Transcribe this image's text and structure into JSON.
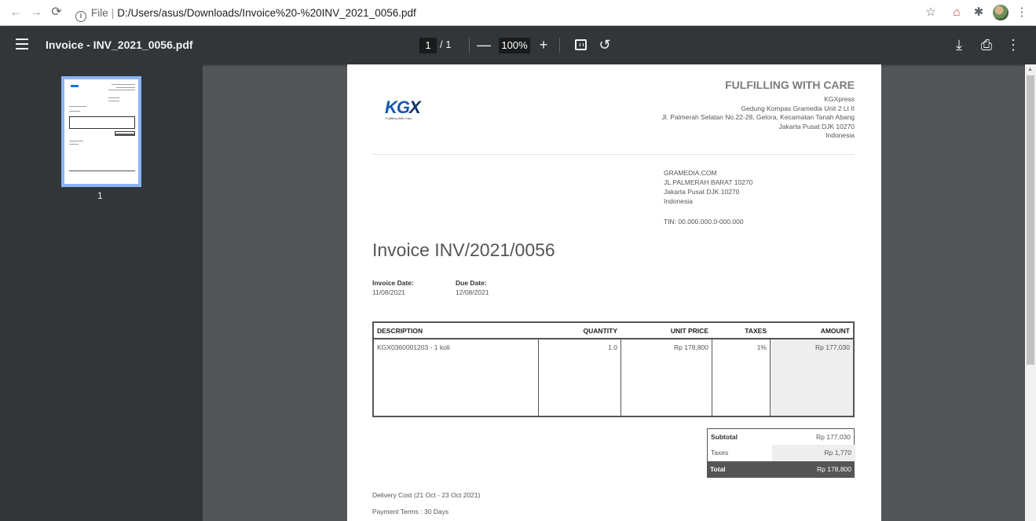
{
  "browser": {
    "nav": {
      "back": "←",
      "forward": "→",
      "reload": "⟳"
    },
    "url": {
      "scheme": "File",
      "path": "D:/Users/asus/Downloads/Invoice%20-%20INV_2021_0056.pdf"
    }
  },
  "viewer": {
    "title": "Invoice - INV_2021_0056.pdf",
    "page_current": "1",
    "page_total": "/ 1",
    "zoom": "100%",
    "zoom_out": "—",
    "zoom_in": "+",
    "rotate": "↺",
    "download": "⤓",
    "print": "⎙",
    "more": "⋮"
  },
  "sidebar": {
    "thumb_label": "1"
  },
  "invoice": {
    "logo": {
      "text_main": "KG",
      "text_x": "X",
      "tagline": "Fulfilling With Care"
    },
    "company": {
      "motto": "FULFILLING WITH CARE",
      "lines": [
        "KGXpress",
        "Gedung Kompas Gramedia Unit 2 Lt II",
        "Jl. Palmerah Selatan No.22-28, Gelora, Kecamatan Tanah Abang",
        "Jakarta Pusat DJK 10270",
        "Indonesia"
      ]
    },
    "customer": {
      "lines": [
        "GRAMEDIA.COM",
        "JL.PALMERAH BARAT 10270",
        "Jakarta Pusat DJK 10270",
        "Indonesia"
      ],
      "tin": "TIN: 00.000.000.0-000.000"
    },
    "title": "Invoice INV/2021/0056",
    "invoice_date": {
      "label": "Invoice Date:",
      "value": "11/08/2021"
    },
    "due_date": {
      "label": "Due Date:",
      "value": "12/08/2021"
    },
    "table": {
      "headers": {
        "description": "DESCRIPTION",
        "quantity": "QUANTITY",
        "unit_price": "UNIT PRICE",
        "taxes": "TAXES",
        "amount": "AMOUNT"
      },
      "rows": [
        {
          "description": "KGX0360001203 - 1 koli",
          "quantity": "1.0",
          "unit_price": "Rp 178,800",
          "taxes": "1%",
          "amount": "Rp 177,030"
        }
      ]
    },
    "totals": {
      "subtotal_label": "Subtotal",
      "subtotal_value": "Rp 177,030",
      "taxes_label": "Taxes",
      "taxes_value": "Rp 1,770",
      "total_label": "Total",
      "total_value": "Rp 178,800"
    },
    "delivery_note": "Delivery Cost (21 Oct - 23 Oct 2021)",
    "payment_terms": "Payment Terms : 30 Days"
  }
}
